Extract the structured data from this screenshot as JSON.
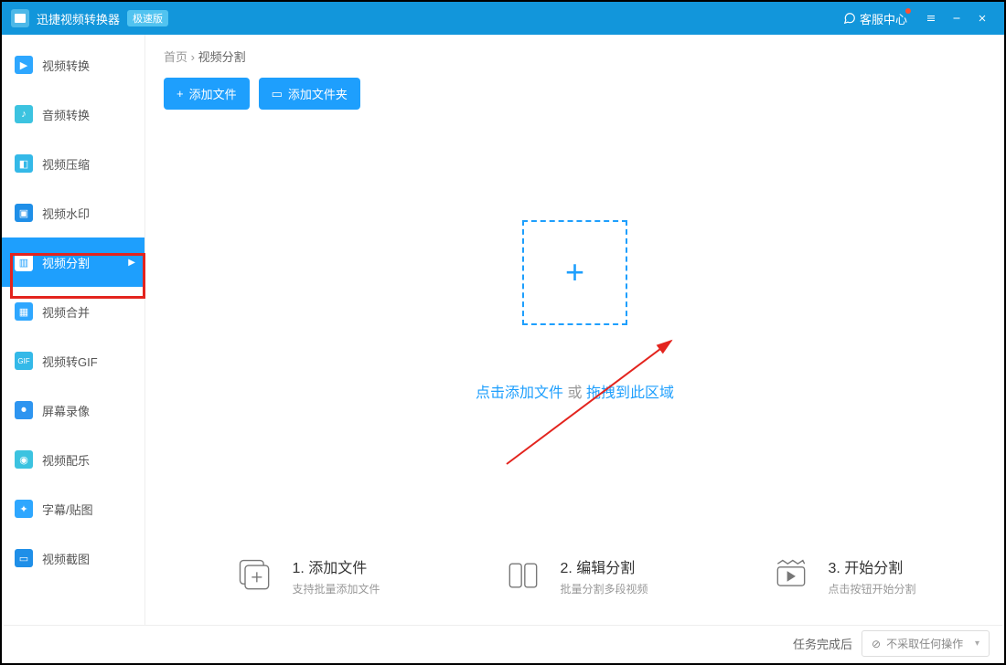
{
  "titlebar": {
    "app_name": "迅捷视频转换器",
    "edition_badge": "极速版",
    "support_label": "客服中心"
  },
  "sidebar": {
    "items": [
      {
        "label": "视频转换"
      },
      {
        "label": "音频转换"
      },
      {
        "label": "视频压缩"
      },
      {
        "label": "视频水印"
      },
      {
        "label": "视频分割"
      },
      {
        "label": "视频合并"
      },
      {
        "label": "视频转GIF"
      },
      {
        "label": "屏幕录像"
      },
      {
        "label": "视频配乐"
      },
      {
        "label": "字幕/贴图"
      },
      {
        "label": "视频截图"
      }
    ]
  },
  "breadcrumb": {
    "home": "首页",
    "sep": "›",
    "current": "视频分割"
  },
  "toolbar": {
    "add_file": "添加文件",
    "add_folder": "添加文件夹"
  },
  "dropzone": {
    "link_click": "点击添加文件",
    "or": " 或 ",
    "link_drag": "拖拽到此区域"
  },
  "steps": [
    {
      "title": "1. 添加文件",
      "sub": "支持批量添加文件"
    },
    {
      "title": "2. 编辑分割",
      "sub": "批量分割多段视频"
    },
    {
      "title": "3. 开始分割",
      "sub": "点击按钮开始分割"
    }
  ],
  "footer": {
    "label": "任务完成后",
    "select_value": "不采取任何操作",
    "select_prefix_icon": "⊘"
  }
}
